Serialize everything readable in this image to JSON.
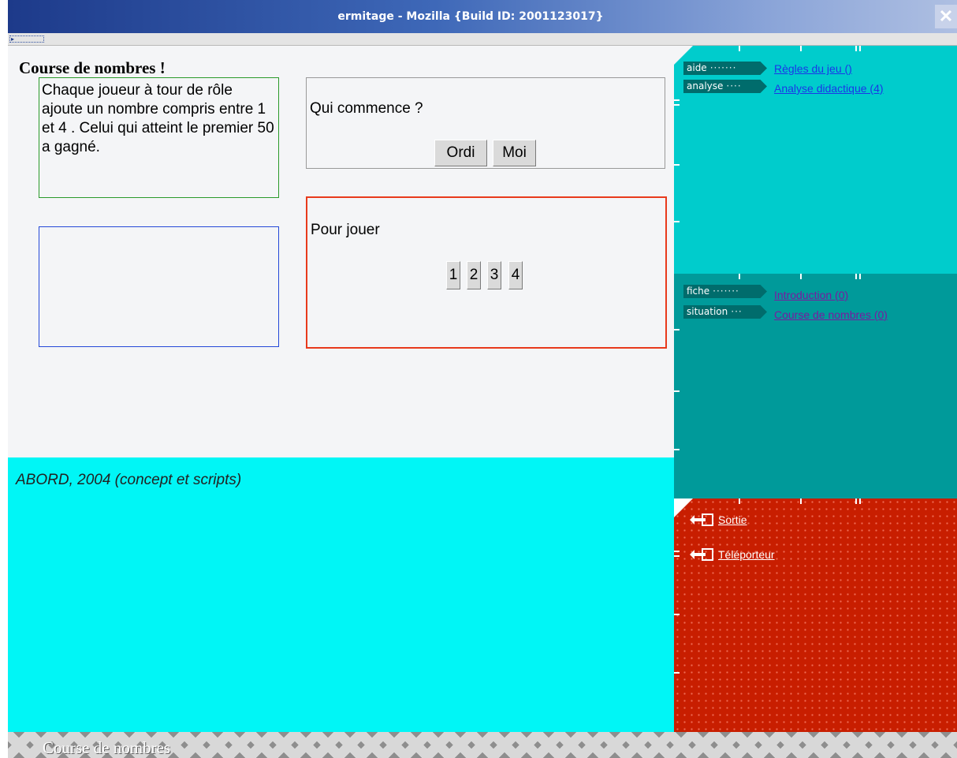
{
  "window": {
    "title": "ermitage - Mozilla {Build ID: 2001123017}",
    "close_glyph": "✕"
  },
  "main": {
    "title": "Course de nombres !",
    "rules_text": "Chaque joueur à tour de rôle ajoute un nombre compris entre 1 et 4 . Celui qui atteint le premier 50 a gagné.",
    "start_question": "Qui commence ?",
    "start_buttons": {
      "computer": "Ordi",
      "me": "Moi"
    },
    "play_label": "Pour jouer",
    "number_buttons": [
      "1",
      "2",
      "3",
      "4"
    ]
  },
  "credits": {
    "text": "ABORD, 2004 (concept et scripts)"
  },
  "panels": {
    "help": {
      "items": [
        {
          "tag": "aide",
          "dots": "·······",
          "link": "Règles du jeu ()"
        },
        {
          "tag": "analyse",
          "dots": "····",
          "link": "Analyse didactique (4)"
        }
      ]
    },
    "sheet": {
      "items": [
        {
          "tag": "fiche",
          "dots": "·······",
          "link": "Introduction (0)"
        },
        {
          "tag": "situation",
          "dots": "···",
          "link": "Course de nombres (0)"
        }
      ]
    },
    "exit": {
      "items": [
        {
          "label": "Sortie",
          "icon": "exit-arrow-icon"
        },
        {
          "label": "Téléporteur",
          "icon": "exit-arrow-icon"
        }
      ]
    }
  },
  "footer": {
    "text": "Course de nombres"
  },
  "colors": {
    "help_panel": "#00cccc",
    "sheet_panel": "#009a9a",
    "exit_panel": "#c81e00",
    "credits_bg": "#00f6f6",
    "rules_border": "#2a9a2a",
    "play_border": "#e83a1c",
    "blue_box_border": "#2448d8"
  }
}
